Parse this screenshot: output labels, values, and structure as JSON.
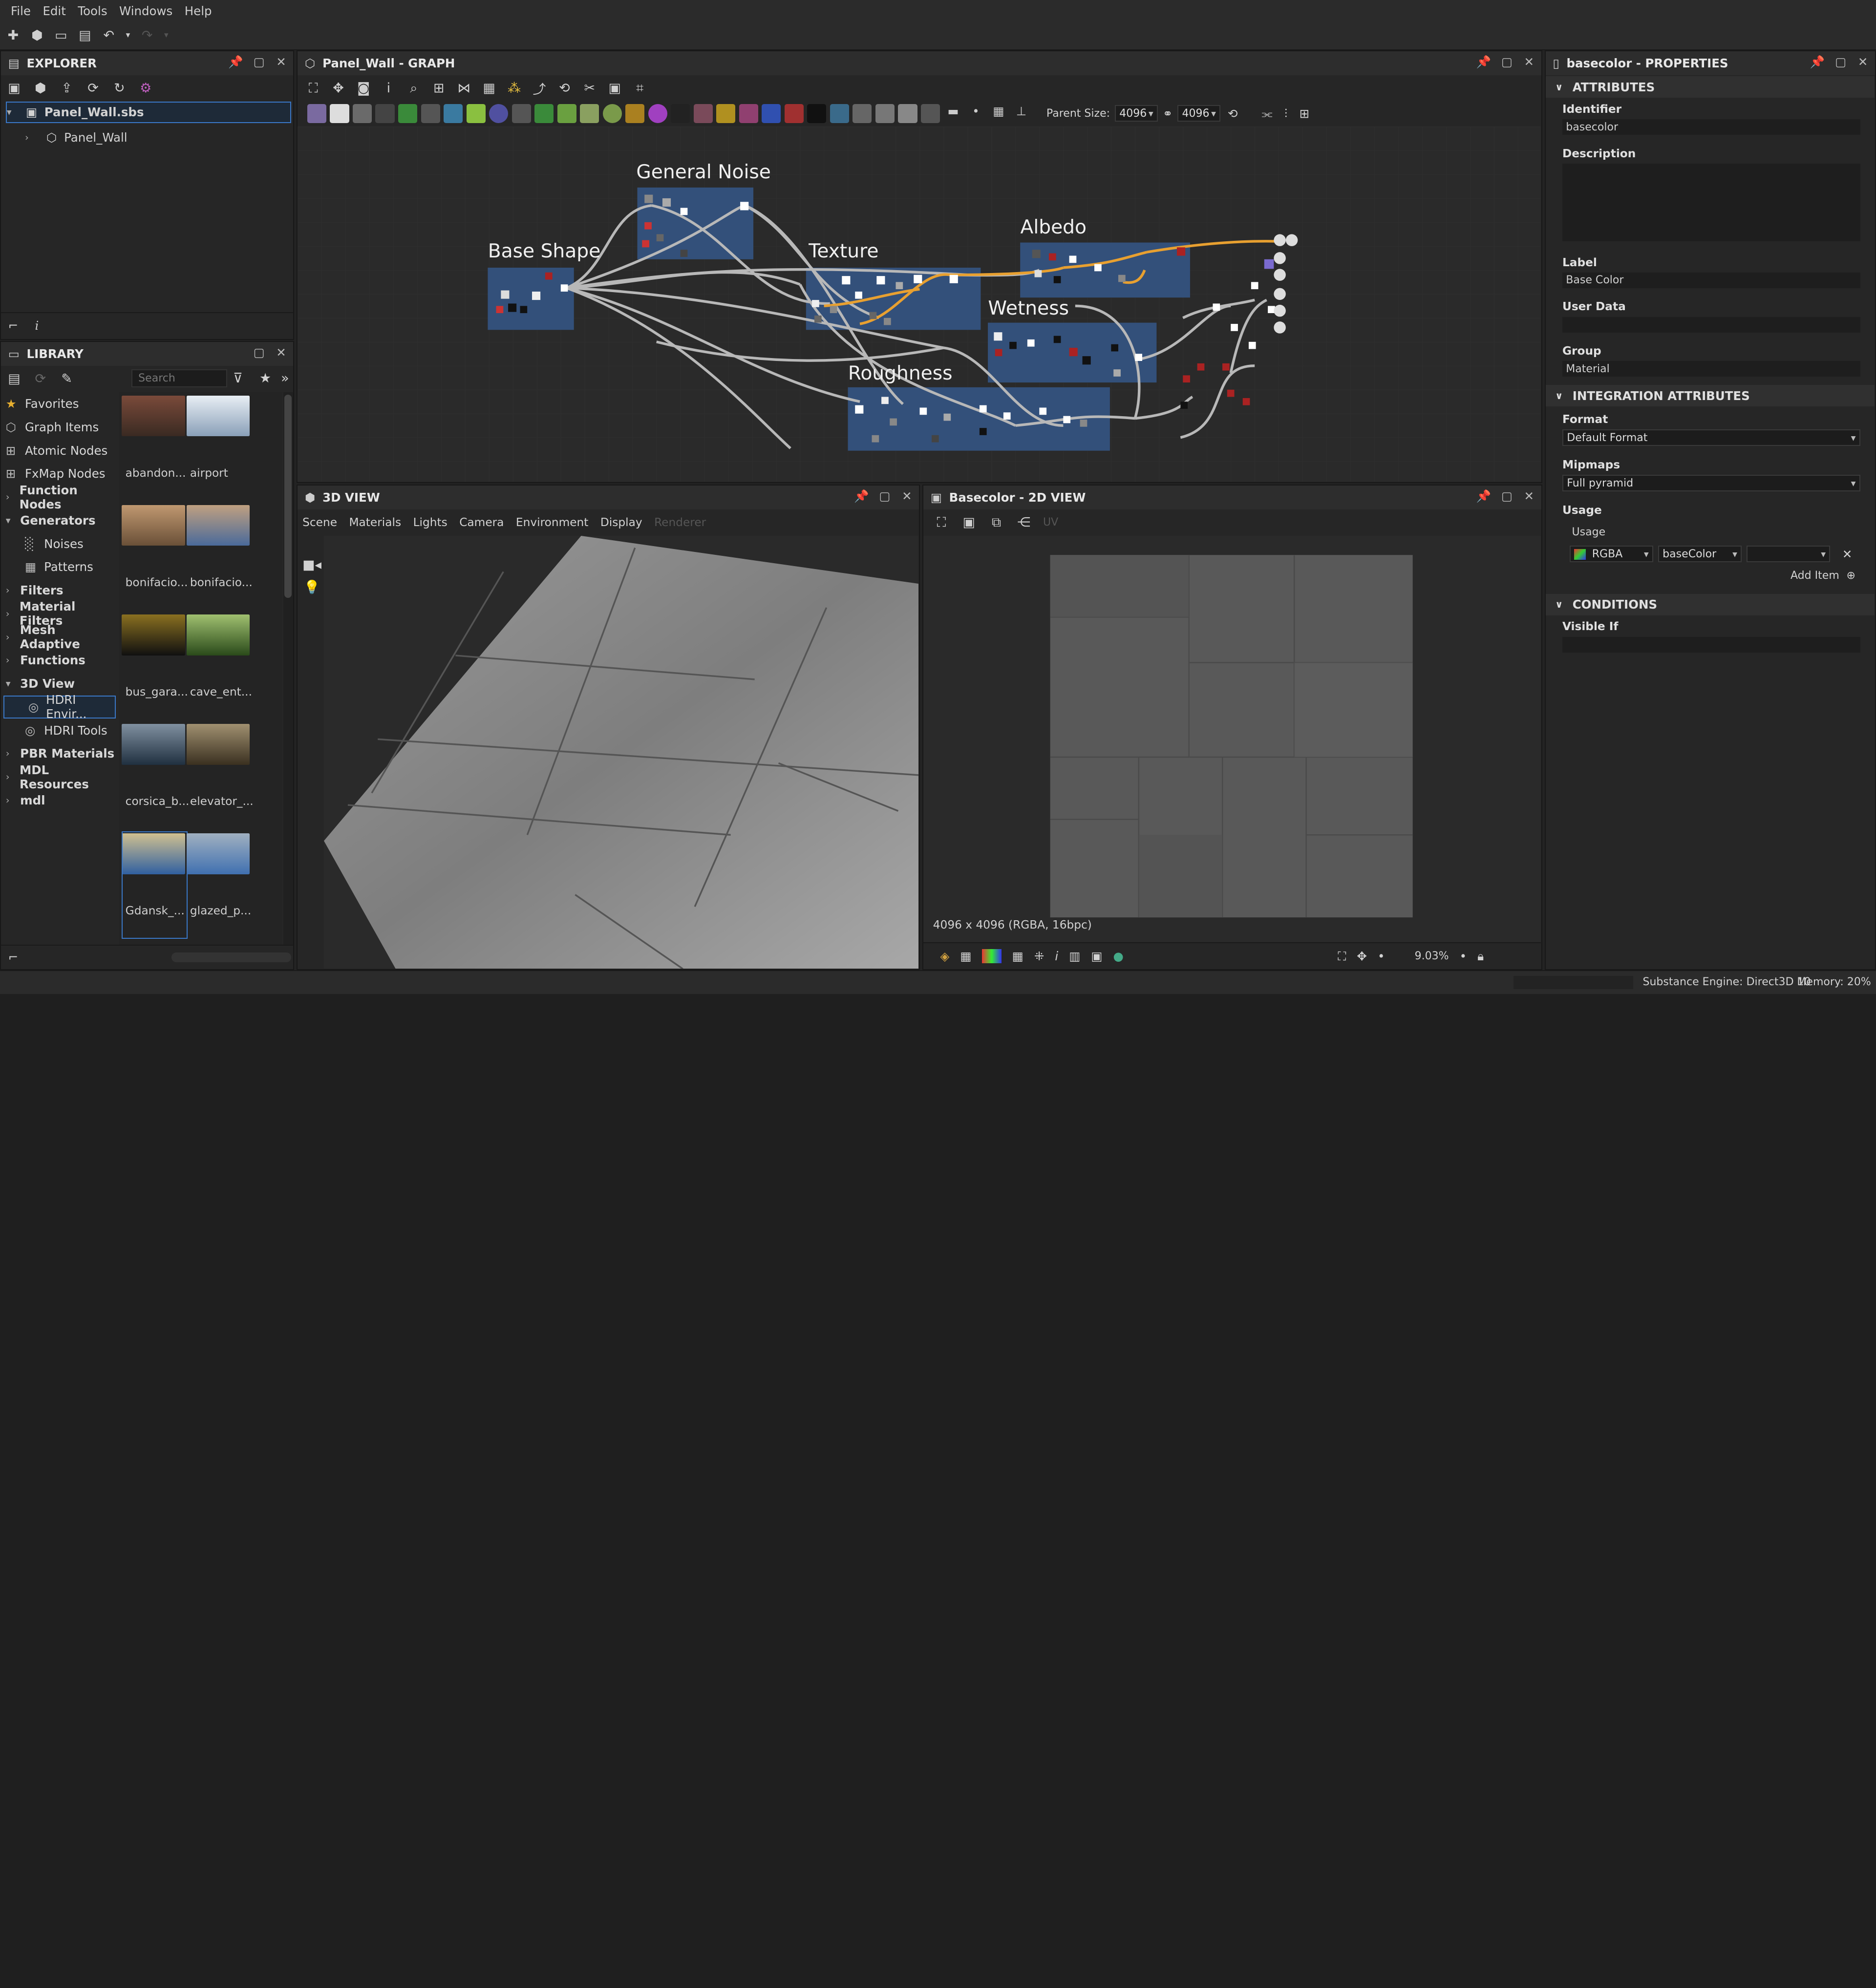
{
  "menu": [
    "File",
    "Edit",
    "Tools",
    "Windows",
    "Help"
  ],
  "explorer": {
    "title": "EXPLORER",
    "file": "Panel_Wall.sbs",
    "graph": "Panel_Wall"
  },
  "library": {
    "title": "LIBRARY",
    "search_placeholder": "Search",
    "categories": [
      {
        "label": "Favorites",
        "icon": "star-icon",
        "bold": false,
        "caret": ""
      },
      {
        "label": "Graph Items",
        "icon": "graph-icon",
        "bold": false,
        "caret": ""
      },
      {
        "label": "Atomic Nodes",
        "icon": "node-icon",
        "bold": false,
        "caret": ""
      },
      {
        "label": "FxMap Nodes",
        "icon": "node-icon",
        "bold": false,
        "caret": ""
      },
      {
        "label": "Function Nodes",
        "icon": "",
        "bold": true,
        "caret": "right"
      },
      {
        "label": "Generators",
        "icon": "",
        "bold": true,
        "caret": "down"
      },
      {
        "label": "Noises",
        "icon": "noise-icon",
        "bold": false,
        "caret": "sub"
      },
      {
        "label": "Patterns",
        "icon": "pattern-icon",
        "bold": false,
        "caret": "sub"
      },
      {
        "label": "Filters",
        "icon": "",
        "bold": true,
        "caret": "right"
      },
      {
        "label": "Material Filters",
        "icon": "",
        "bold": true,
        "caret": "right"
      },
      {
        "label": "Mesh Adaptive",
        "icon": "",
        "bold": true,
        "caret": "right"
      },
      {
        "label": "Functions",
        "icon": "",
        "bold": true,
        "caret": "right"
      },
      {
        "label": "3D View",
        "icon": "",
        "bold": true,
        "caret": "down"
      },
      {
        "label": "HDRI Envir...",
        "icon": "globe-icon",
        "bold": false,
        "caret": "sub",
        "selected": true
      },
      {
        "label": "HDRI Tools",
        "icon": "globe-icon",
        "bold": false,
        "caret": "sub"
      },
      {
        "label": "PBR Materials",
        "icon": "",
        "bold": true,
        "caret": "right"
      },
      {
        "label": "MDL Resources",
        "icon": "",
        "bold": true,
        "caret": "right"
      },
      {
        "label": "mdl",
        "icon": "",
        "bold": true,
        "caret": "right"
      }
    ],
    "thumbs": [
      {
        "label": "abandon...",
        "colors": [
          "#3a2a22",
          "#7a4a3a"
        ]
      },
      {
        "label": "airport",
        "colors": [
          "#8aa0b8",
          "#e8eef4"
        ]
      },
      {
        "label": "bonifacio...",
        "colors": [
          "#6a5038",
          "#c09870"
        ]
      },
      {
        "label": "bonifacio...",
        "colors": [
          "#4a6a9a",
          "#c0a080"
        ]
      },
      {
        "label": "bus_gara...",
        "colors": [
          "#101010",
          "#8a7020"
        ]
      },
      {
        "label": "cave_ent...",
        "colors": [
          "#2a4a1a",
          "#a0c070"
        ]
      },
      {
        "label": "corsica_b...",
        "colors": [
          "#203040",
          "#8090a0"
        ]
      },
      {
        "label": "elevator_...",
        "colors": [
          "#3a3020",
          "#a09070"
        ]
      },
      {
        "label": "Gdansk_...",
        "colors": [
          "#3060a0",
          "#d0c090"
        ]
      },
      {
        "label": "glazed_p...",
        "colors": [
          "#4070b0",
          "#a0b0c0"
        ]
      }
    ]
  },
  "graph": {
    "title": "Panel_Wall - GRAPH",
    "parent_size_label": "Parent Size:",
    "parent_w": "4096",
    "parent_h": "4096",
    "frames": [
      "General Noise",
      "Base Shape",
      "Texture",
      "Albedo",
      "Wetness",
      "Roughness"
    ]
  },
  "view3d": {
    "title": "3D VIEW",
    "menu": [
      "Scene",
      "Materials",
      "Lights",
      "Camera",
      "Environment",
      "Display",
      "Renderer"
    ]
  },
  "view2d": {
    "title": "Basecolor - 2D VIEW",
    "uv": "UV",
    "resolution": "4096 x 4096 (RGBA, 16bpc)",
    "zoom": "9.03%"
  },
  "properties": {
    "title": "basecolor - PROPERTIES",
    "attributes_header": "ATTRIBUTES",
    "identifier_label": "Identifier",
    "identifier": "basecolor",
    "description_label": "Description",
    "label_label": "Label",
    "label": "Base Color",
    "userdata_label": "User Data",
    "group_label": "Group",
    "group": "Material",
    "integration_header": "INTEGRATION ATTRIBUTES",
    "format_label": "Format",
    "format": "Default Format",
    "mipmaps_label": "Mipmaps",
    "mipmaps": "Full pyramid",
    "usage_label": "Usage",
    "usage_sub": "Usage",
    "usage_channel": "RGBA",
    "usage_name": "baseColor",
    "add_item": "Add Item",
    "conditions_header": "CONDITIONS",
    "visible_if_label": "Visible If"
  },
  "status": {
    "engine": "Substance Engine: Direct3D 10",
    "memory": "Memory: 20%"
  }
}
